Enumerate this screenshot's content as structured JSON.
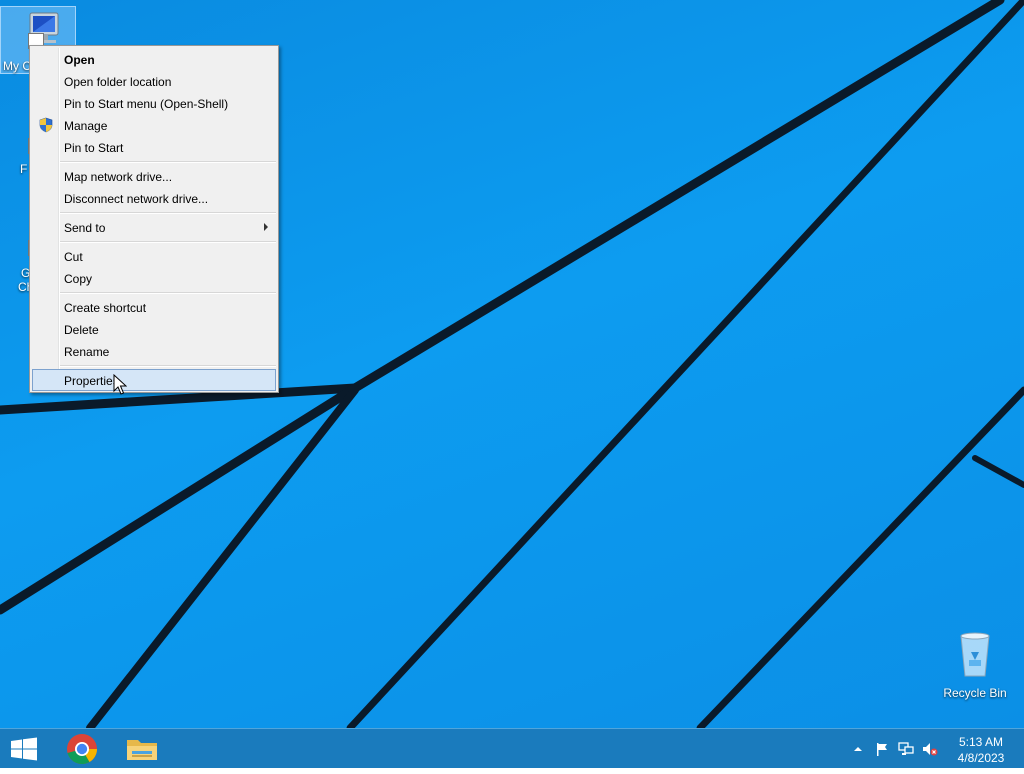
{
  "desktop": {
    "icons": {
      "my_computer": "My C",
      "firefox": "F",
      "chrome_line1": "G",
      "chrome_line2": "Ch",
      "recycle_bin": "Recycle Bin"
    }
  },
  "context_menu": {
    "items": [
      {
        "label": "Open",
        "bold": true
      },
      {
        "label": "Open folder location"
      },
      {
        "label": "Pin to Start menu (Open-Shell)"
      },
      {
        "label": "Manage",
        "icon": "uac-shield-icon"
      },
      {
        "label": "Pin to Start"
      },
      {
        "label": "Map network drive..."
      },
      {
        "label": "Disconnect network drive..."
      },
      {
        "label": "Send to",
        "submenu": true
      },
      {
        "label": "Cut"
      },
      {
        "label": "Copy"
      },
      {
        "label": "Create shortcut"
      },
      {
        "label": "Delete"
      },
      {
        "label": "Rename"
      },
      {
        "label": "Properties",
        "highlighted": true
      }
    ]
  },
  "taskbar": {
    "pinned": [
      "start-icon",
      "chrome-icon",
      "file-explorer-icon"
    ],
    "tray_icons": [
      "show-hidden-icons-chevron",
      "action-center-flag-icon",
      "network-icon",
      "volume-muted-icon"
    ],
    "clock": {
      "time": "5:13 AM",
      "date": "4/8/2023"
    }
  },
  "colors": {
    "desktop_bg": "#0d9cf0",
    "taskbar_bg": "#1a7bbd",
    "menu_bg": "#f0f0f0",
    "menu_highlight": "#d5e6f7"
  }
}
